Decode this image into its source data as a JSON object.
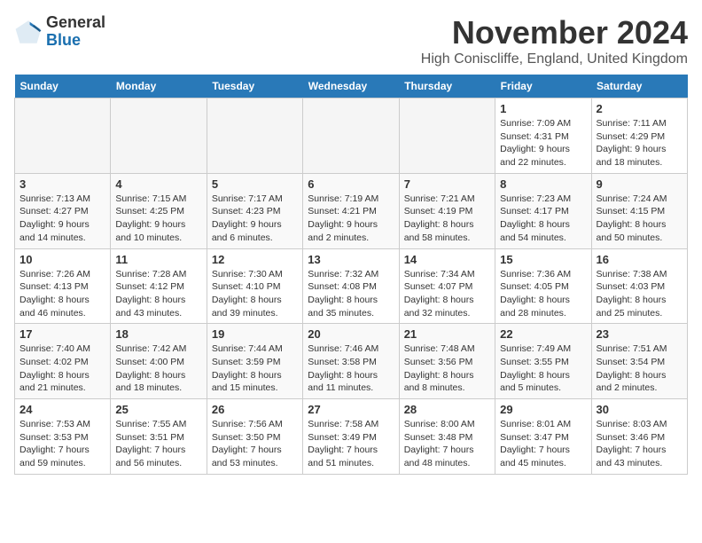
{
  "logo": {
    "line1": "General",
    "line2": "Blue"
  },
  "title": "November 2024",
  "location": "High Coniscliffe, England, United Kingdom",
  "days_of_week": [
    "Sunday",
    "Monday",
    "Tuesday",
    "Wednesday",
    "Thursday",
    "Friday",
    "Saturday"
  ],
  "weeks": [
    [
      {
        "day": "",
        "info": ""
      },
      {
        "day": "",
        "info": ""
      },
      {
        "day": "",
        "info": ""
      },
      {
        "day": "",
        "info": ""
      },
      {
        "day": "",
        "info": ""
      },
      {
        "day": "1",
        "info": "Sunrise: 7:09 AM\nSunset: 4:31 PM\nDaylight: 9 hours and 22 minutes."
      },
      {
        "day": "2",
        "info": "Sunrise: 7:11 AM\nSunset: 4:29 PM\nDaylight: 9 hours and 18 minutes."
      }
    ],
    [
      {
        "day": "3",
        "info": "Sunrise: 7:13 AM\nSunset: 4:27 PM\nDaylight: 9 hours and 14 minutes."
      },
      {
        "day": "4",
        "info": "Sunrise: 7:15 AM\nSunset: 4:25 PM\nDaylight: 9 hours and 10 minutes."
      },
      {
        "day": "5",
        "info": "Sunrise: 7:17 AM\nSunset: 4:23 PM\nDaylight: 9 hours and 6 minutes."
      },
      {
        "day": "6",
        "info": "Sunrise: 7:19 AM\nSunset: 4:21 PM\nDaylight: 9 hours and 2 minutes."
      },
      {
        "day": "7",
        "info": "Sunrise: 7:21 AM\nSunset: 4:19 PM\nDaylight: 8 hours and 58 minutes."
      },
      {
        "day": "8",
        "info": "Sunrise: 7:23 AM\nSunset: 4:17 PM\nDaylight: 8 hours and 54 minutes."
      },
      {
        "day": "9",
        "info": "Sunrise: 7:24 AM\nSunset: 4:15 PM\nDaylight: 8 hours and 50 minutes."
      }
    ],
    [
      {
        "day": "10",
        "info": "Sunrise: 7:26 AM\nSunset: 4:13 PM\nDaylight: 8 hours and 46 minutes."
      },
      {
        "day": "11",
        "info": "Sunrise: 7:28 AM\nSunset: 4:12 PM\nDaylight: 8 hours and 43 minutes."
      },
      {
        "day": "12",
        "info": "Sunrise: 7:30 AM\nSunset: 4:10 PM\nDaylight: 8 hours and 39 minutes."
      },
      {
        "day": "13",
        "info": "Sunrise: 7:32 AM\nSunset: 4:08 PM\nDaylight: 8 hours and 35 minutes."
      },
      {
        "day": "14",
        "info": "Sunrise: 7:34 AM\nSunset: 4:07 PM\nDaylight: 8 hours and 32 minutes."
      },
      {
        "day": "15",
        "info": "Sunrise: 7:36 AM\nSunset: 4:05 PM\nDaylight: 8 hours and 28 minutes."
      },
      {
        "day": "16",
        "info": "Sunrise: 7:38 AM\nSunset: 4:03 PM\nDaylight: 8 hours and 25 minutes."
      }
    ],
    [
      {
        "day": "17",
        "info": "Sunrise: 7:40 AM\nSunset: 4:02 PM\nDaylight: 8 hours and 21 minutes."
      },
      {
        "day": "18",
        "info": "Sunrise: 7:42 AM\nSunset: 4:00 PM\nDaylight: 8 hours and 18 minutes."
      },
      {
        "day": "19",
        "info": "Sunrise: 7:44 AM\nSunset: 3:59 PM\nDaylight: 8 hours and 15 minutes."
      },
      {
        "day": "20",
        "info": "Sunrise: 7:46 AM\nSunset: 3:58 PM\nDaylight: 8 hours and 11 minutes."
      },
      {
        "day": "21",
        "info": "Sunrise: 7:48 AM\nSunset: 3:56 PM\nDaylight: 8 hours and 8 minutes."
      },
      {
        "day": "22",
        "info": "Sunrise: 7:49 AM\nSunset: 3:55 PM\nDaylight: 8 hours and 5 minutes."
      },
      {
        "day": "23",
        "info": "Sunrise: 7:51 AM\nSunset: 3:54 PM\nDaylight: 8 hours and 2 minutes."
      }
    ],
    [
      {
        "day": "24",
        "info": "Sunrise: 7:53 AM\nSunset: 3:53 PM\nDaylight: 7 hours and 59 minutes."
      },
      {
        "day": "25",
        "info": "Sunrise: 7:55 AM\nSunset: 3:51 PM\nDaylight: 7 hours and 56 minutes."
      },
      {
        "day": "26",
        "info": "Sunrise: 7:56 AM\nSunset: 3:50 PM\nDaylight: 7 hours and 53 minutes."
      },
      {
        "day": "27",
        "info": "Sunrise: 7:58 AM\nSunset: 3:49 PM\nDaylight: 7 hours and 51 minutes."
      },
      {
        "day": "28",
        "info": "Sunrise: 8:00 AM\nSunset: 3:48 PM\nDaylight: 7 hours and 48 minutes."
      },
      {
        "day": "29",
        "info": "Sunrise: 8:01 AM\nSunset: 3:47 PM\nDaylight: 7 hours and 45 minutes."
      },
      {
        "day": "30",
        "info": "Sunrise: 8:03 AM\nSunset: 3:46 PM\nDaylight: 7 hours and 43 minutes."
      }
    ]
  ]
}
